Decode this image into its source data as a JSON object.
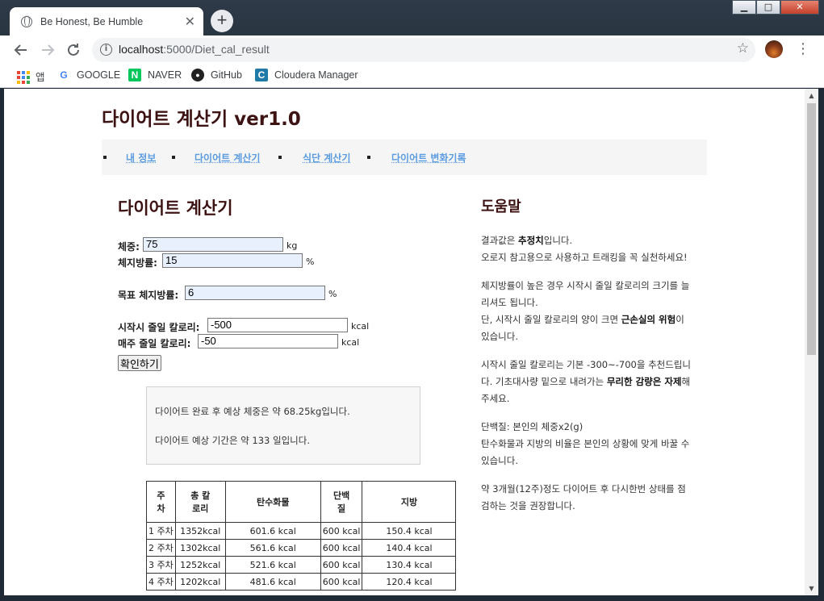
{
  "browser": {
    "tab_title": "Be Honest, Be Humble",
    "tab_close": "✕",
    "new_tab": "+",
    "url_host": "localhost",
    "url_path": ":5000/Diet_cal_result",
    "bookmarks": [
      "앱",
      "GOOGLE",
      "NAVER",
      "GitHub",
      "Cloudera Manager"
    ],
    "icons": [
      "globe-icon",
      "back-icon",
      "forward-icon",
      "reload-icon",
      "info-icon",
      "star-icon",
      "avatar",
      "menu-icon",
      "apps-icon",
      "google-icon",
      "naver-icon",
      "github-icon",
      "cloudera-icon"
    ]
  },
  "site": {
    "title": "다이어트 계산기 ver1.0",
    "menu": [
      "내 정보",
      "다이어트 계산기",
      "식단 계산기",
      "다이어트 변화기록"
    ]
  },
  "calc": {
    "title": "다이어트 계산기",
    "weight": {
      "label": "체중:",
      "value": "75",
      "unit": "kg"
    },
    "bodyfat": {
      "label": "체지방률:",
      "value": "15",
      "unit": "%"
    },
    "target_bodyfat": {
      "label": "목표 체지방률:",
      "value": "6",
      "unit": "%"
    },
    "start_cut": {
      "label": "시작시 줄일 칼로리:",
      "value": "-500",
      "unit": "kcal"
    },
    "weekly_cut": {
      "label": "매주 줄일 칼로리:",
      "value": "-50",
      "unit": "kcal"
    },
    "submit_label": "확인하기",
    "result": {
      "line1": "다이어트 완료 후 예상 체중은 약 68.25kg입니다.",
      "line2": "다이어트 예상 기간은 약 133 일입니다."
    },
    "table": {
      "headers": [
        "주\n차",
        "총 칼\n로리",
        "탄수화물",
        "단백\n질",
        "지방"
      ],
      "rows": [
        [
          "1 주차",
          "1352kcal",
          "601.6 kcal",
          "600 kcal",
          "150.4 kcal"
        ],
        [
          "2 주차",
          "1302kcal",
          "561.6 kcal",
          "600 kcal",
          "140.4 kcal"
        ],
        [
          "3 주차",
          "1252kcal",
          "521.6 kcal",
          "600 kcal",
          "130.4 kcal"
        ],
        [
          "4 주차",
          "1202kcal",
          "481.6 kcal",
          "600 kcal",
          "120.4 kcal"
        ]
      ]
    }
  },
  "help": {
    "title": "도움말",
    "p1a": "결과값은 ",
    "p1b": "추정치",
    "p1c": "입니다.",
    "p1d": "오로지 참고용으로 사용하고 트래킹을 꼭 실천하세요!",
    "p2a": "체지방률이 높은 경우 시작시 줄일 칼로리의 크기를 늘리셔도 됩니다.",
    "p2b": "단, 시작시 줄일 칼로리의 양이 크면 ",
    "p2c": "근손실의 위험",
    "p2d": "이 있습니다.",
    "p3a": "시작시 줄일 칼로리는 기본 -300~-700을 추천드립니다. 기초대사량 밑으로 내려가는 ",
    "p3b": "무리한 감량은 자제",
    "p3c": "해주세요.",
    "p4a": "단백질: 본인의 체중x2(g)",
    "p4b": "탄수화물과 지방의 비율은 본인의 상황에 맞게 바꿀 수 있습니다.",
    "p5": "약 3개월(12주)정도 다이어트 후 다시한번 상태를 점검하는 것을 권장합니다."
  }
}
